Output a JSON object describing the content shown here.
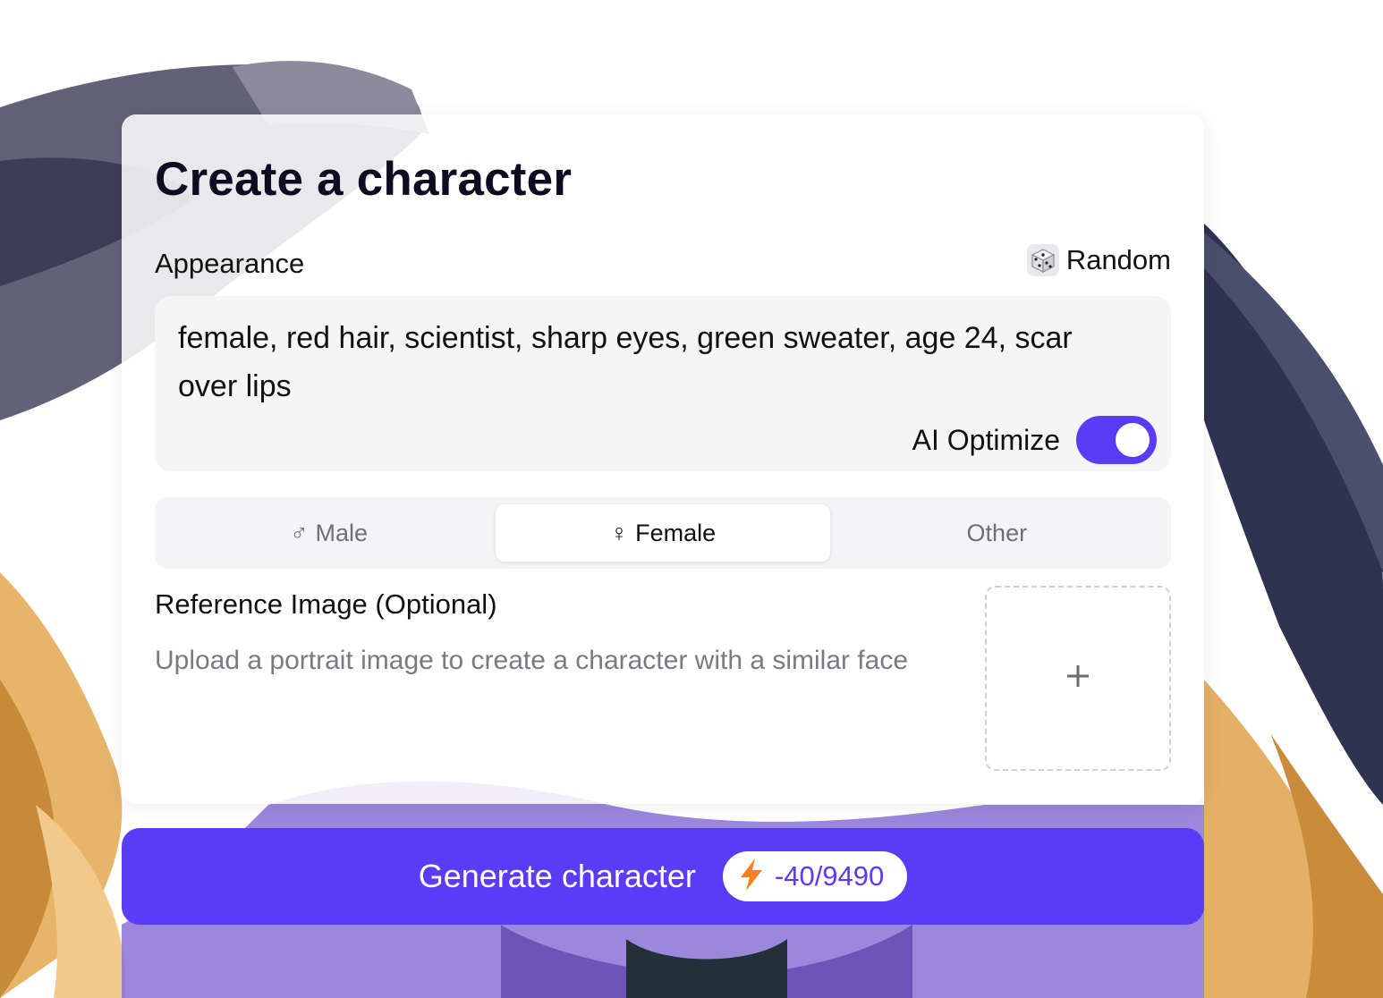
{
  "page": {
    "title": "Create a character"
  },
  "appearance": {
    "label": "Appearance",
    "random_label": "Random",
    "random_icon": "dice-icon",
    "prompt_text": "female, red hair, scientist, sharp eyes, green sweater, age 24, scar over lips",
    "ai_optimize_label": "AI Optimize",
    "ai_optimize_on": true
  },
  "gender": {
    "options": [
      {
        "symbol": "♂",
        "label": "Male",
        "selected": false
      },
      {
        "symbol": "♀",
        "label": "Female",
        "selected": true
      },
      {
        "symbol": "",
        "label": "Other",
        "selected": false
      }
    ]
  },
  "reference": {
    "title": "Reference Image (Optional)",
    "description": "Upload a portrait image to create a character with a similar face",
    "upload_icon": "plus-icon"
  },
  "generate": {
    "label": "Generate character",
    "credit_icon": "lightning-icon",
    "credits": "-40/9490"
  },
  "colors": {
    "accent": "#5a3bf6",
    "lightning": "#f5821f"
  }
}
